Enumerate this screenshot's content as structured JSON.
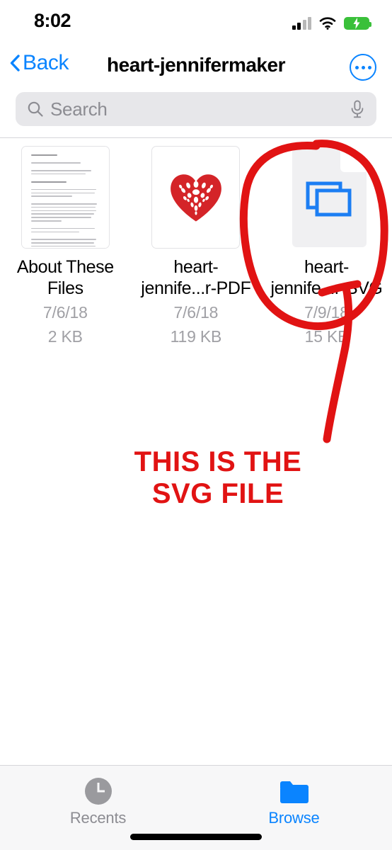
{
  "status_bar": {
    "time": "8:02",
    "signal_icon": "cellular-signal-icon",
    "signal_bars_filled": 2,
    "signal_bars_total": 4,
    "wifi_icon": "wifi-icon",
    "battery_icon": "battery-charging-icon",
    "battery_color": "#3ac03a"
  },
  "nav_bar": {
    "back_label": "Back",
    "back_icon": "chevron-left-icon",
    "title": "heart-jennifermaker",
    "more_icon": "ellipsis-circle-icon",
    "accent_color": "#0a84ff"
  },
  "search": {
    "placeholder": "Search",
    "value": "",
    "search_icon": "search-icon",
    "mic_icon": "microphone-icon"
  },
  "files": [
    {
      "name": "About These Files",
      "date": "7/6/18",
      "size": "2 KB",
      "thumb_type": "document-preview",
      "icon": "text-document-thumbnail"
    },
    {
      "name": "heart-jennife...r-PDF",
      "date": "7/6/18",
      "size": "119 KB",
      "thumb_type": "image-preview",
      "icon": "red-heart-thumbnail"
    },
    {
      "name": "heart-jennife...r-SVG",
      "date": "7/9/18",
      "size": "15 KB",
      "thumb_type": "file-type-icon",
      "icon": "svg-file-icon"
    }
  ],
  "annotation": {
    "line1": "THIS IS THE",
    "line2": "SVG FILE",
    "color": "#e11313",
    "circle_icon": "hand-drawn-ellipse",
    "arrow_icon": "hand-drawn-arrow"
  },
  "tab_bar": {
    "tabs": [
      {
        "label": "Recents",
        "icon": "clock-icon",
        "active": false
      },
      {
        "label": "Browse",
        "icon": "folder-icon",
        "active": true
      }
    ],
    "active_color": "#0a84ff",
    "inactive_color": "#8c8c92"
  }
}
